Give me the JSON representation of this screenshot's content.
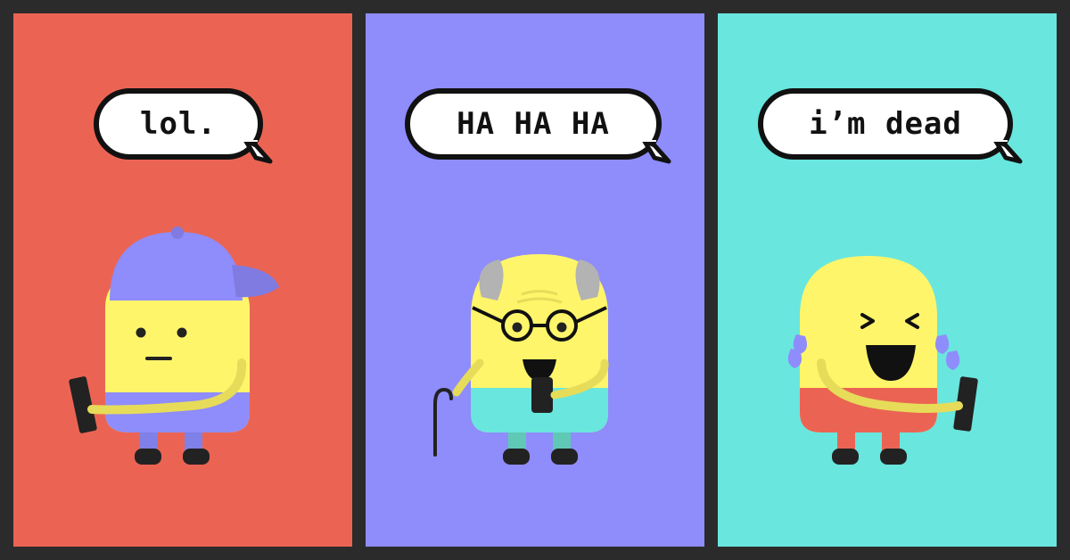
{
  "panels": [
    {
      "name": "teen",
      "bubble_text": "lol.",
      "background": "#eb6453"
    },
    {
      "name": "grandpa",
      "bubble_text": "HA HA HA",
      "background": "#8f8cfb"
    },
    {
      "name": "crying-laughing",
      "bubble_text": "i’m dead",
      "background": "#69e6de"
    }
  ],
  "colors": {
    "frame": "#2b2b2b",
    "character_yellow": "#fff56a",
    "outline": "#111111",
    "bubble_fill": "#ffffff"
  }
}
